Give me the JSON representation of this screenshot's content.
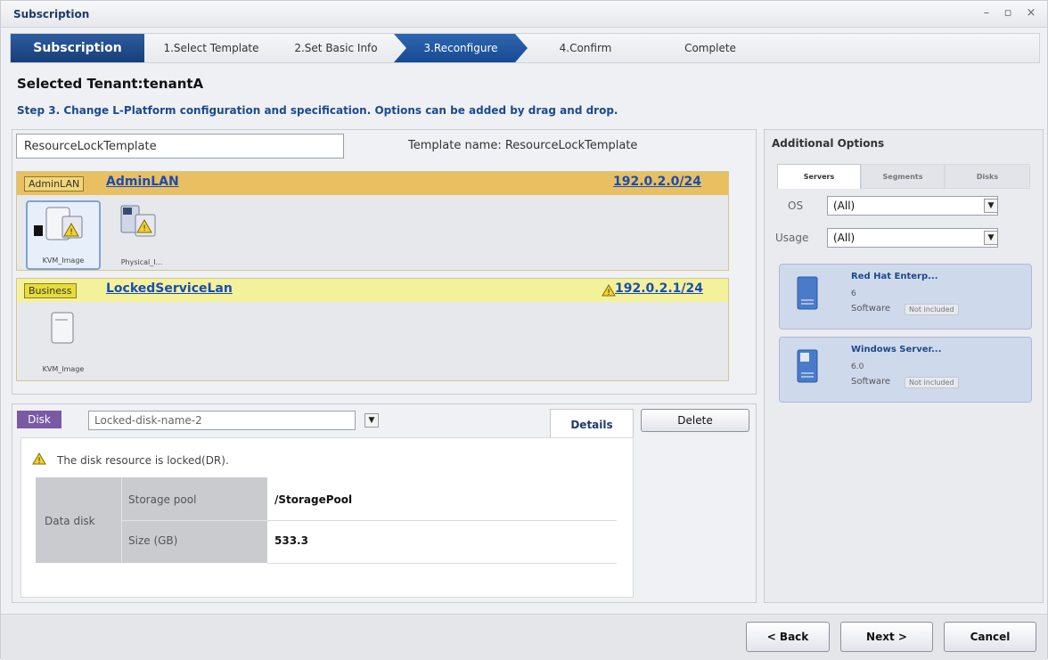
{
  "window": {
    "title": "Subscription"
  },
  "steps": {
    "main": "Subscription",
    "items": [
      "1.Select Template",
      "2.Set Basic Info",
      "3.Reconfigure",
      "4.Confirm",
      "Complete"
    ]
  },
  "tenant_heading": "Selected Tenant:tenantA",
  "step_instruction": "Step 3. Change L-Platform configuration and specification. Options can be added by drag and drop.",
  "config": {
    "name_input_value": "ResourceLockTemplate",
    "template_name_label": "Template name: ResourceLockTemplate",
    "lans": [
      {
        "tag": "AdminLAN",
        "name": "AdminLAN",
        "subnet": "192.0.2.0/24",
        "servers": [
          {
            "caption": "KVM_Image"
          },
          {
            "caption": "Physical_I..."
          }
        ]
      },
      {
        "tag": "Business",
        "name": "LockedServiceLan",
        "subnet": "192.0.2.1/24",
        "servers": [
          {
            "caption": "KVM_Image"
          }
        ]
      }
    ]
  },
  "disk": {
    "tag": "Disk",
    "select_value": "Locked-disk-name-2",
    "details_tab": "Details",
    "delete_label": "Delete",
    "locked_message": "The disk resource is locked(DR).",
    "table": {
      "group_label": "Data disk",
      "rows": [
        {
          "key": "Storage pool",
          "value": "/StoragePool"
        },
        {
          "key": "Size (GB)",
          "value": "533.3"
        }
      ]
    }
  },
  "options": {
    "title": "Additional Options",
    "tabs": [
      "Servers",
      "Segments",
      "Disks"
    ],
    "filters": {
      "os_label": "OS",
      "os_value": "(All)",
      "usage_label": "Usage",
      "usage_value": "(All)"
    },
    "items": [
      {
        "name": "Red Hat Enterp...",
        "version": "6",
        "kind": "Software",
        "badge": "Not included",
        "icon": "linux-server-icon"
      },
      {
        "name": "Windows Server...",
        "version": "6.0",
        "kind": "Software",
        "badge": "Not included",
        "icon": "windows-server-icon"
      }
    ]
  },
  "footer": {
    "back": "< Back",
    "next": "Next >",
    "cancel": "Cancel"
  },
  "colors": {
    "brand": "#173e7a",
    "admin_lan": "#e8c062",
    "business_lan": "#f4f19b",
    "disk_tag": "#7a5aa5",
    "link": "#1a4cb5"
  }
}
